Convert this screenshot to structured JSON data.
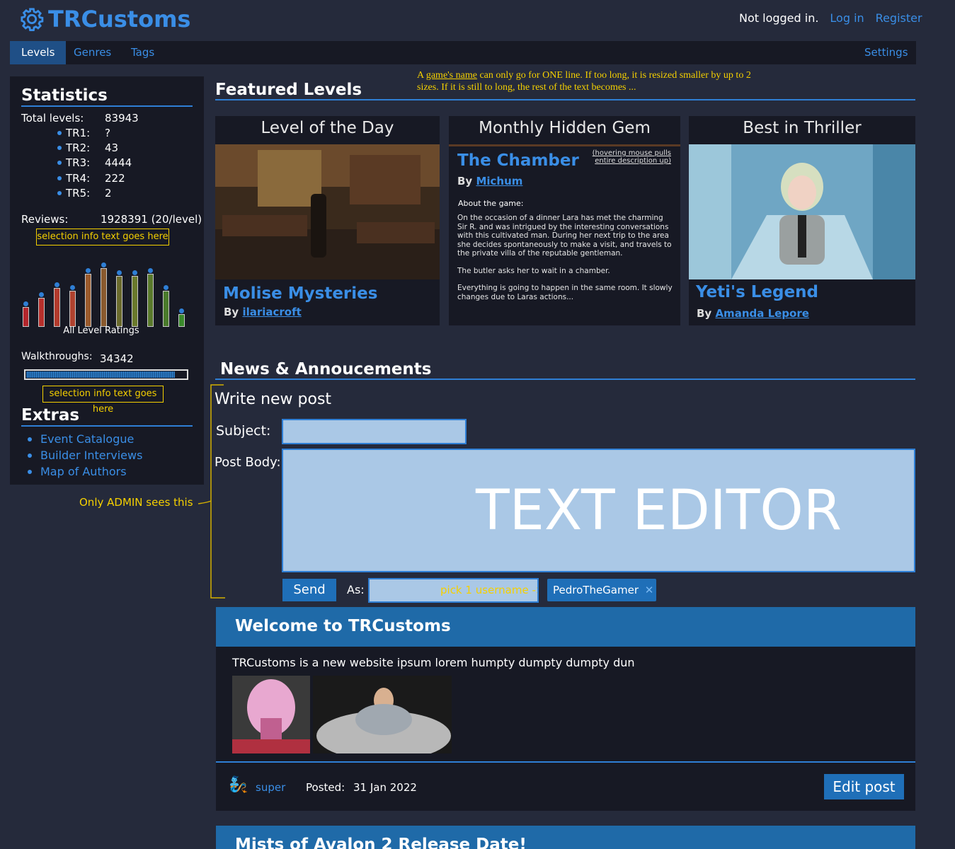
{
  "header": {
    "brand": "TRCustoms",
    "auth_status": "Not logged in.",
    "login": "Log in",
    "register": "Register"
  },
  "nav": {
    "tabs": [
      "Levels",
      "Genres",
      "Tags"
    ],
    "active": "Levels",
    "settings": "Settings"
  },
  "stats": {
    "title": "Statistics",
    "total_label": "Total levels:",
    "total_value": "83943",
    "engines": [
      {
        "name": "TR1:",
        "value": "?"
      },
      {
        "name": "TR2:",
        "value": "43"
      },
      {
        "name": "TR3:",
        "value": "4444"
      },
      {
        "name": "TR4:",
        "value": "222"
      },
      {
        "name": "TR5:",
        "value": "2"
      }
    ],
    "reviews_label": "Reviews:",
    "reviews_value": "1928391 (20/level)",
    "selection_info_1": "selection info text goes here",
    "ratings_caption": "All Level Ratings",
    "ratings": [
      0.3,
      0.45,
      0.6,
      0.55,
      0.82,
      0.9,
      0.78,
      0.78,
      0.82,
      0.55,
      0.2
    ],
    "walkthroughs_label": "Walkthroughs:",
    "walkthroughs_value": "34342",
    "walkthroughs_fraction": 0.92,
    "selection_info_2": "selection info text goes here"
  },
  "extras": {
    "title": "Extras",
    "items": [
      "Event Catalogue",
      "Builder Interviews",
      "Map of Authors"
    ]
  },
  "admin_note": "Only ADMIN sees this",
  "featured": {
    "title": "Featured Levels",
    "note_prefix": "A ",
    "note_link": "game's name",
    "note_rest": " can only go for ONE line. If too long, it is resized smaller by up to 2 sizes. If it is still to long, the rest of the text becomes ...",
    "cards": [
      {
        "heading": "Level of the Day",
        "name": "Molise Mysteries",
        "by": "By",
        "author": "ilariacroft"
      },
      {
        "heading": "Monthly Hidden Gem",
        "name": "The Chamber",
        "by": "By",
        "author": "Michum",
        "hover_note": "(hovering mouse pulls entire description up)",
        "about": "About the game:",
        "desc": [
          "On the occasion of a dinner Lara has met the charming Sir R. and was intrigued by the interesting conversations with this cultivated man. During her next trip to the area she decides spontaneously to make a visit, and travels to the private villa of the reputable gentleman.",
          "The butler asks her to wait in a chamber.",
          "Everything is going to happen in the same room. It slowly changes due to Laras actions..."
        ]
      },
      {
        "heading": "Best in Thriller",
        "name": "Yeti's Legend",
        "by": "By",
        "author": "Amanda Lepore"
      }
    ]
  },
  "news": {
    "title": "News & Annoucements",
    "write_title": "Write new post",
    "subject_label": "Subject:",
    "body_label": "Post Body:",
    "editor_placeholder": "TEXT EDITOR",
    "send": "Send",
    "as_label": "As:",
    "username_hint": "pick 1 username ->",
    "chip_user": "PedroTheGamer",
    "posts": [
      {
        "title": "Welcome to TRCustoms",
        "body": "TRCustoms is a new website ipsum lorem humpty dumpty dumpty dun",
        "author": "super",
        "posted_label": "Posted:",
        "date": "31 Jan 2022",
        "edit": "Edit post"
      },
      {
        "title": "Mists of Avalon 2 Release Date!"
      }
    ]
  },
  "colors": {
    "accent": "#3a8ee6",
    "note": "#f5d000",
    "bg": "#252a3b",
    "panel": "#171924",
    "input": "#aac8e6"
  }
}
